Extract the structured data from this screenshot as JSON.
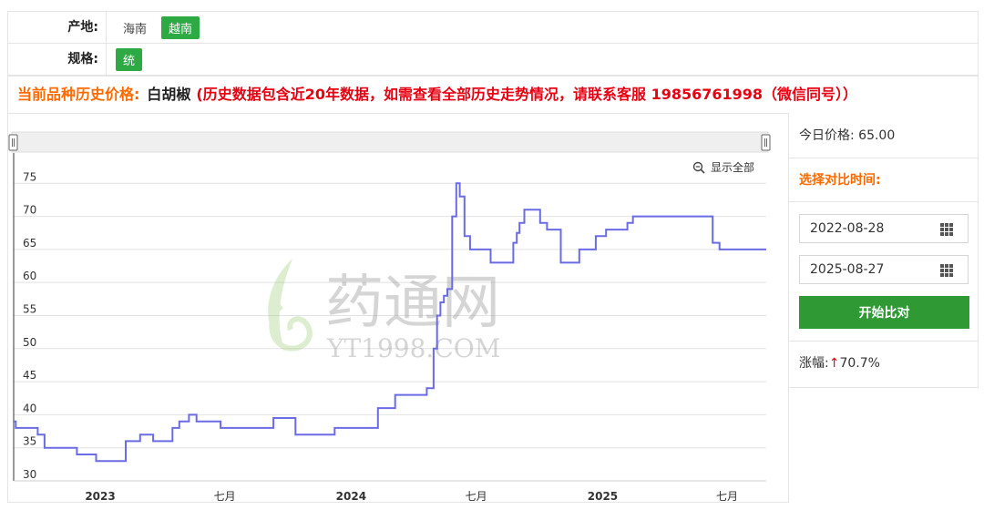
{
  "filters": {
    "origin": {
      "label": "产地:",
      "options": [
        "海南",
        "越南"
      ],
      "active": "越南"
    },
    "spec": {
      "label": "规格:",
      "options": [
        "统"
      ],
      "active": "统"
    }
  },
  "history": {
    "label": "当前品种历史价格:",
    "product": "白胡椒",
    "note": "(历史数据包含近20年数据，如需查看全部历史走势情况，请联系客服 19856761998（微信同号））"
  },
  "chart": {
    "show_all_label": "显示全部",
    "watermark_main": "药通网",
    "watermark_sub": "YT1998.COM"
  },
  "side": {
    "today_label": "今日价格:",
    "today_value": "65.00",
    "compare_title": "选择对比时间:",
    "start_date": "2022-08-28",
    "end_date": "2025-08-27",
    "compare_button": "开始比对",
    "change_label": "涨幅:",
    "change_arrow": "↑",
    "change_value": "70.7%"
  },
  "colors": {
    "line": "#6b6be6",
    "accent_orange": "#ff6a00",
    "accent_red": "#e60012",
    "green": "#2eaa45",
    "button_green": "#2f9a34"
  },
  "chart_data": {
    "type": "line",
    "step": true,
    "title": "",
    "xlabel": "",
    "ylabel": "",
    "x_range": [
      "2022-08-28",
      "2025-08-27"
    ],
    "ylim": [
      30,
      76
    ],
    "y_ticks": [
      30,
      35,
      40,
      45,
      50,
      55,
      60,
      65,
      70,
      75
    ],
    "x_ticks": [
      {
        "date": "2023-01-01",
        "label": "2023",
        "bold": true
      },
      {
        "date": "2023-07-01",
        "label": "七月",
        "bold": false
      },
      {
        "date": "2024-01-01",
        "label": "2024",
        "bold": true
      },
      {
        "date": "2024-07-01",
        "label": "七月",
        "bold": false
      },
      {
        "date": "2025-01-01",
        "label": "2025",
        "bold": true
      },
      {
        "date": "2025-07-01",
        "label": "七月",
        "bold": false
      }
    ],
    "series": [
      {
        "points": [
          [
            "2022-08-28",
            39
          ],
          [
            "2022-08-31",
            38
          ],
          [
            "2022-10-02",
            37
          ],
          [
            "2022-10-12",
            35
          ],
          [
            "2022-11-28",
            34
          ],
          [
            "2022-12-26",
            33
          ],
          [
            "2023-02-07",
            36
          ],
          [
            "2023-02-28",
            37
          ],
          [
            "2023-03-19",
            36
          ],
          [
            "2023-04-16",
            38
          ],
          [
            "2023-04-26",
            39
          ],
          [
            "2023-05-10",
            40
          ],
          [
            "2023-05-21",
            39
          ],
          [
            "2023-06-25",
            38
          ],
          [
            "2023-09-10",
            39.5
          ],
          [
            "2023-10-12",
            37
          ],
          [
            "2023-12-08",
            38
          ],
          [
            "2024-02-09",
            41
          ],
          [
            "2024-03-05",
            43
          ],
          [
            "2024-04-20",
            44
          ],
          [
            "2024-04-30",
            50
          ],
          [
            "2024-05-05",
            55
          ],
          [
            "2024-05-10",
            57
          ],
          [
            "2024-05-15",
            58
          ],
          [
            "2024-05-20",
            59
          ],
          [
            "2024-05-27",
            70
          ],
          [
            "2024-06-02",
            75
          ],
          [
            "2024-06-07",
            73
          ],
          [
            "2024-06-14",
            67
          ],
          [
            "2024-06-22",
            65
          ],
          [
            "2024-07-22",
            63
          ],
          [
            "2024-08-24",
            66
          ],
          [
            "2024-08-29",
            67.5
          ],
          [
            "2024-09-02",
            69
          ],
          [
            "2024-09-09",
            71
          ],
          [
            "2024-10-02",
            69
          ],
          [
            "2024-10-12",
            68
          ],
          [
            "2024-11-01",
            63
          ],
          [
            "2024-11-28",
            65
          ],
          [
            "2024-12-22",
            67
          ],
          [
            "2025-01-06",
            68
          ],
          [
            "2025-02-06",
            69
          ],
          [
            "2025-02-14",
            70
          ],
          [
            "2025-06-10",
            66
          ],
          [
            "2025-06-20",
            65
          ],
          [
            "2025-08-27",
            65
          ]
        ]
      }
    ]
  }
}
